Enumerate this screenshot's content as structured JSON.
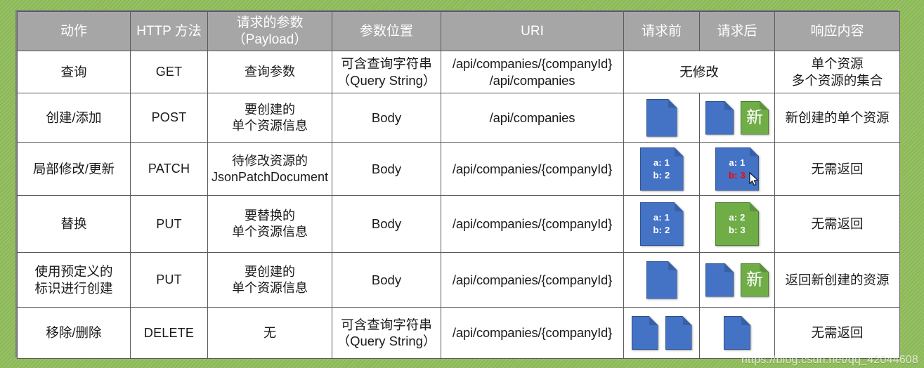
{
  "table": {
    "headers": [
      {
        "lines": [
          "动作"
        ]
      },
      {
        "lines": [
          "HTTP 方法"
        ]
      },
      {
        "lines": [
          "请求的参数",
          "（Payload）"
        ]
      },
      {
        "lines": [
          "参数位置"
        ]
      },
      {
        "lines": [
          "URI"
        ]
      },
      {
        "lines": [
          "请求前"
        ]
      },
      {
        "lines": [
          "请求后"
        ]
      },
      {
        "lines": [
          "响应内容"
        ]
      }
    ],
    "rows": [
      {
        "action": [
          "查询"
        ],
        "method": [
          "GET"
        ],
        "payload": [
          "查询参数"
        ],
        "position": [
          "可含查询字符串",
          "（Query String）"
        ],
        "uri": [
          "/api/companies/{companyId}",
          "/api/companies"
        ],
        "before_after_merged": [
          "无修改"
        ],
        "response": [
          "单个资源",
          "多个资源的集合"
        ]
      },
      {
        "action": [
          "创建/添加"
        ],
        "method": [
          "POST"
        ],
        "payload": [
          "要创建的",
          "单个资源信息"
        ],
        "position": [
          "Body"
        ],
        "uri": [
          "/api/companies"
        ],
        "response": [
          "新创建的单个资源"
        ]
      },
      {
        "action": [
          "局部修改/更新"
        ],
        "method": [
          "PATCH"
        ],
        "payload": [
          "待修改资源的",
          "JsonPatchDocument"
        ],
        "position": [
          "Body"
        ],
        "uri": [
          "/api/companies/{companyId}"
        ],
        "response": [
          "无需返回"
        ]
      },
      {
        "action": [
          "替换"
        ],
        "method": [
          "PUT"
        ],
        "payload": [
          "要替换的",
          "单个资源信息"
        ],
        "position": [
          "Body"
        ],
        "uri": [
          "/api/companies/{companyId}"
        ],
        "response": [
          "无需返回"
        ]
      },
      {
        "action": [
          "使用预定义的",
          "标识进行创建"
        ],
        "method": [
          "PUT"
        ],
        "payload": [
          "要创建的",
          "单个资源信息"
        ],
        "position": [
          "Body"
        ],
        "uri": [
          "/api/companies/{companyId}"
        ],
        "response": [
          "返回新创建的资源"
        ]
      },
      {
        "action": [
          "移除/删除"
        ],
        "method": [
          "DELETE"
        ],
        "payload": [
          "无"
        ],
        "position": [
          "可含查询字符串",
          "（Query String）"
        ],
        "uri": [
          "/api/companies/{companyId}"
        ],
        "response": [
          "无需返回"
        ]
      }
    ]
  },
  "icons": {
    "badge_new_label": "新",
    "patch_before": {
      "a": "a: 1",
      "b": "b: 2"
    },
    "patch_after": {
      "a": "a: 1",
      "b": "b: 3"
    },
    "put_before": {
      "a": "a: 1",
      "b": "b: 2"
    },
    "put_after": {
      "a": "a: 2",
      "b": "b: 3"
    }
  },
  "colors": {
    "header_bg": "#a6a6a6",
    "header_text": "#ffffff",
    "doc_blue": "#4472c4",
    "doc_green": "#70ad47",
    "changed_value": "#ff0000",
    "background_green": "#8fbc5a",
    "border": "#5a5a5a"
  },
  "watermark": {
    "text": "https://blog.csdn.net/qq_42044608"
  }
}
